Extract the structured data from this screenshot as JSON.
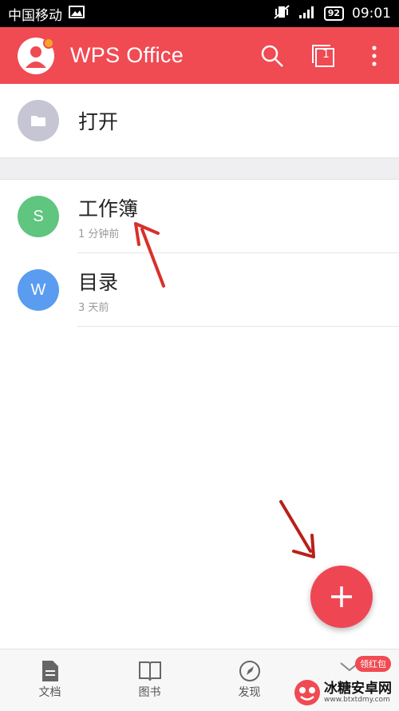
{
  "status_bar": {
    "carrier": "中国移动",
    "battery": "92",
    "time": "09:01"
  },
  "app_bar": {
    "title": "WPS Office",
    "tab_count": "1"
  },
  "open_item": {
    "label": "打开"
  },
  "recent_files": [
    {
      "name": "工作簿",
      "time": "1 分钟前",
      "icon_letter": "S",
      "color": "#5fc57f"
    },
    {
      "name": "目录",
      "time": "3 天前",
      "icon_letter": "W",
      "color": "#5a9cf0"
    }
  ],
  "bottom_nav": {
    "items": [
      {
        "label": "文档",
        "icon": "document-icon"
      },
      {
        "label": "图书",
        "icon": "book-icon"
      },
      {
        "label": "发现",
        "icon": "compass-icon"
      }
    ],
    "badge": "领红包"
  },
  "watermark": {
    "name": "冰糖安卓网",
    "url": "www.btxtdmy.com"
  },
  "colors": {
    "brand_red": "#f04a53",
    "folder_circle": "#c5c5d3"
  }
}
